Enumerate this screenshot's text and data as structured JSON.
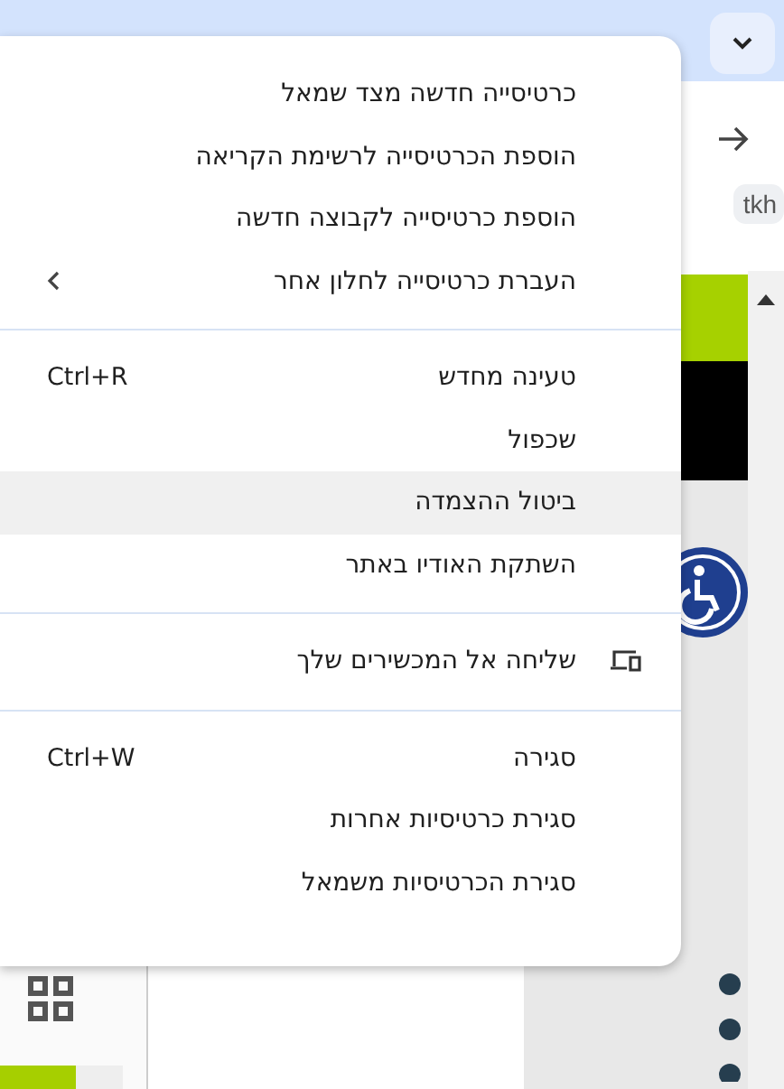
{
  "toolbar": {
    "chip": "tkh"
  },
  "context_menu": {
    "sections": [
      [
        {
          "kind": "plain",
          "label": "כרטיסייה חדשה מצד שמאל",
          "selected": false
        },
        {
          "kind": "plain",
          "label": "הוספת הכרטיסייה לרשימת הקריאה",
          "selected": false
        },
        {
          "kind": "plain",
          "label": "הוספת כרטיסייה לקבוצה חדשה",
          "selected": false
        },
        {
          "kind": "submenu",
          "label": "העברת כרטיסייה לחלון אחר",
          "selected": false
        }
      ],
      [
        {
          "kind": "plain",
          "label": "טעינה מחדש",
          "shortcut": "Ctrl+R",
          "selected": false
        },
        {
          "kind": "plain",
          "label": "שכפול",
          "selected": false
        },
        {
          "kind": "plain",
          "label": "ביטול ההצמדה",
          "selected": true
        },
        {
          "kind": "plain",
          "label": "השתקת האודיו באתר",
          "selected": false
        }
      ],
      [
        {
          "kind": "device",
          "label": "שליחה אל המכשירים שלך",
          "selected": false
        }
      ],
      [
        {
          "kind": "plain",
          "label": "סגירה",
          "shortcut": "Ctrl+W",
          "selected": false
        },
        {
          "kind": "plain",
          "label": "סגירת כרטיסיות אחרות",
          "selected": false
        },
        {
          "kind": "plain",
          "label": "סגירת הכרטיסיות משמאל",
          "selected": false
        }
      ]
    ]
  }
}
